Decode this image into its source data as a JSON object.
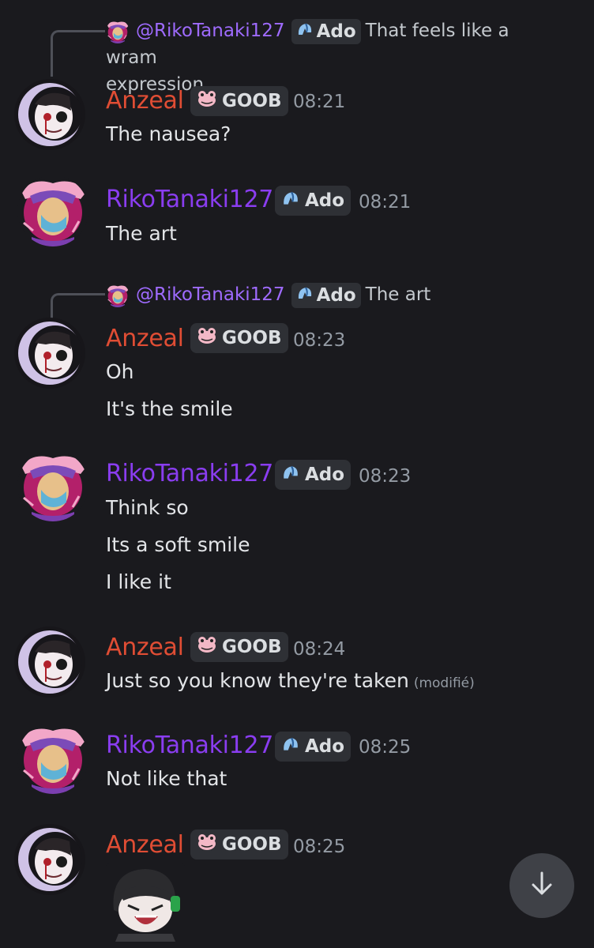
{
  "messages": [
    {
      "reply": {
        "mention": "@RikoTanaki127",
        "tag": "Ado",
        "text": "That feels like a wram",
        "text2": "expression"
      },
      "author": "Anzeal",
      "tag": "GOOB",
      "time": "08:21",
      "lines": [
        "The nausea?"
      ]
    },
    {
      "author": "RikoTanaki127",
      "tag": "Ado",
      "time": "08:21",
      "lines": [
        "The art"
      ]
    },
    {
      "reply": {
        "mention": "@RikoTanaki127",
        "tag": "Ado",
        "text": "The art"
      },
      "author": "Anzeal",
      "tag": "GOOB",
      "time": "08:23",
      "lines": [
        "Oh",
        "It's the smile"
      ]
    },
    {
      "author": "RikoTanaki127",
      "tag": "Ado",
      "time": "08:23",
      "lines": [
        "Think so",
        "Its a soft smile",
        "I like it"
      ]
    },
    {
      "author": "Anzeal",
      "tag": "GOOB",
      "time": "08:24",
      "lines": [
        "Just so you know they're taken"
      ],
      "edited": "(modifié)"
    },
    {
      "author": "RikoTanaki127",
      "tag": "Ado",
      "time": "08:25",
      "lines": [
        "Not like that"
      ]
    },
    {
      "author": "Anzeal",
      "tag": "GOOB",
      "time": "08:25",
      "sticker": "sticker-image"
    }
  ],
  "colors": {
    "anzeal": "#e04d34",
    "riko": "#8a3df0",
    "background": "#1a1a1e"
  },
  "icons": {
    "scroll": "arrow-down-icon",
    "goob": "frog-icon",
    "ado": "ado-badge-icon"
  }
}
